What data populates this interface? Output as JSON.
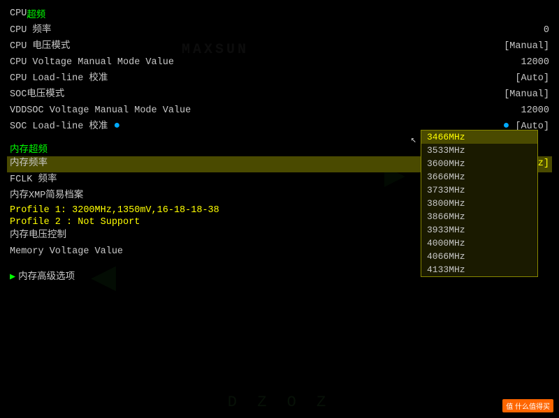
{
  "bios": {
    "sections": {
      "cpu_oc": {
        "label_cn": "CPU ",
        "label_oc": "超频"
      },
      "rows": [
        {
          "label": "CPU 频率",
          "value": "0",
          "value_type": "plain"
        },
        {
          "label": "CPU 电压模式",
          "value": "[Manual]",
          "value_type": "bracket"
        },
        {
          "label": "CPU Voltage Manual Mode Value",
          "value": "12000",
          "value_type": "plain"
        },
        {
          "label": "CPU Load-line 校准",
          "value": "[Auto]",
          "value_type": "bracket"
        },
        {
          "label": "SOC电压模式",
          "value": "[Manual]",
          "value_type": "bracket"
        },
        {
          "label": "VDDSOC Voltage Manual Mode Value",
          "value": "12000",
          "value_type": "plain"
        },
        {
          "label": "SOC Load-line 校准",
          "value": "[Auto]",
          "value_type": "bracket",
          "has_dot": true
        }
      ],
      "memory_oc": "内存超频",
      "memory_rows": [
        {
          "label": "内存频率",
          "value": "[3466MHz]",
          "highlighted": true
        },
        {
          "label": "FCLK 频率",
          "value": ""
        },
        {
          "label": "内存XMP简易档案",
          "value": ""
        }
      ],
      "profile_info": [
        "Profile 1: 3200MHz,1350mV,16-18-18-38",
        "Profile 2 : Not Support"
      ],
      "more_rows": [
        {
          "label": "内存电压控制",
          "value": ""
        },
        {
          "label": "Memory Voltage Value",
          "value": ""
        }
      ],
      "advanced": "▶ 内存高级选项"
    },
    "dropdown": {
      "items": [
        {
          "value": "3466MHz",
          "selected": true
        },
        {
          "value": "3533MHz",
          "selected": false
        },
        {
          "value": "3600MHz",
          "selected": false
        },
        {
          "value": "3666MHz",
          "selected": false
        },
        {
          "value": "3733MHz",
          "selected": false
        },
        {
          "value": "3800MHz",
          "selected": false
        },
        {
          "value": "3866MHz",
          "selected": false
        },
        {
          "value": "3933MHz",
          "selected": false
        },
        {
          "value": "4000MHz",
          "selected": false
        },
        {
          "value": "4066MHz",
          "selected": false
        },
        {
          "value": "4133MHz",
          "selected": false
        }
      ]
    },
    "logo": "MAXSUN",
    "smzdm": "值 什么值得买"
  }
}
